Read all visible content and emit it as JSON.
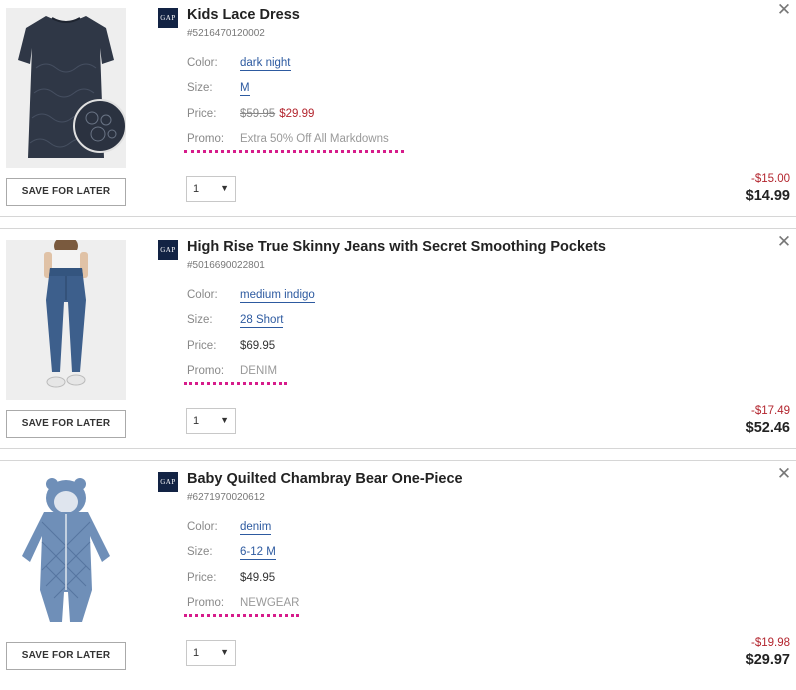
{
  "cart": {
    "items": [
      {
        "brand": "GAP",
        "title": "Kids Lace Dress",
        "sku": "#5216470120002",
        "labels": {
          "color": "Color:",
          "size": "Size:",
          "price": "Price:",
          "promo": "Promo:"
        },
        "color": "dark night",
        "size": "M",
        "price_original": "$59.95",
        "price_sale": "$29.99",
        "price": "",
        "promo": "Extra 50% Off All Markdowns",
        "qty": "1",
        "discount": "-$15.00",
        "total": "$14.99",
        "save_label": "SAVE FOR LATER"
      },
      {
        "brand": "GAP",
        "title": "High Rise True Skinny Jeans with Secret Smoothing Pockets",
        "sku": "#5016690022801",
        "labels": {
          "color": "Color:",
          "size": "Size:",
          "price": "Price:",
          "promo": "Promo:"
        },
        "color": "medium indigo",
        "size": "28 Short",
        "price": "$69.95",
        "promo": "DENIM",
        "qty": "1",
        "discount": "-$17.49",
        "total": "$52.46",
        "save_label": "SAVE FOR LATER"
      },
      {
        "brand": "GAP",
        "title": "Baby Quilted Chambray Bear One-Piece",
        "sku": "#6271970020612",
        "labels": {
          "color": "Color:",
          "size": "Size:",
          "price": "Price:",
          "promo": "Promo:"
        },
        "color": "denim",
        "size": "6-12 M",
        "price": "$49.95",
        "promo": "NEWGEAR",
        "qty": "1",
        "discount": "-$19.98",
        "total": "$29.97",
        "save_label": "SAVE FOR LATER"
      }
    ]
  },
  "icons": {
    "close": "close-icon",
    "dropdown": "chevron-down-icon"
  },
  "colors": {
    "link": "#2d5aa0",
    "sale": "#b3252e",
    "promo_underline": "#d61c8b",
    "brand_bg": "#122344"
  }
}
